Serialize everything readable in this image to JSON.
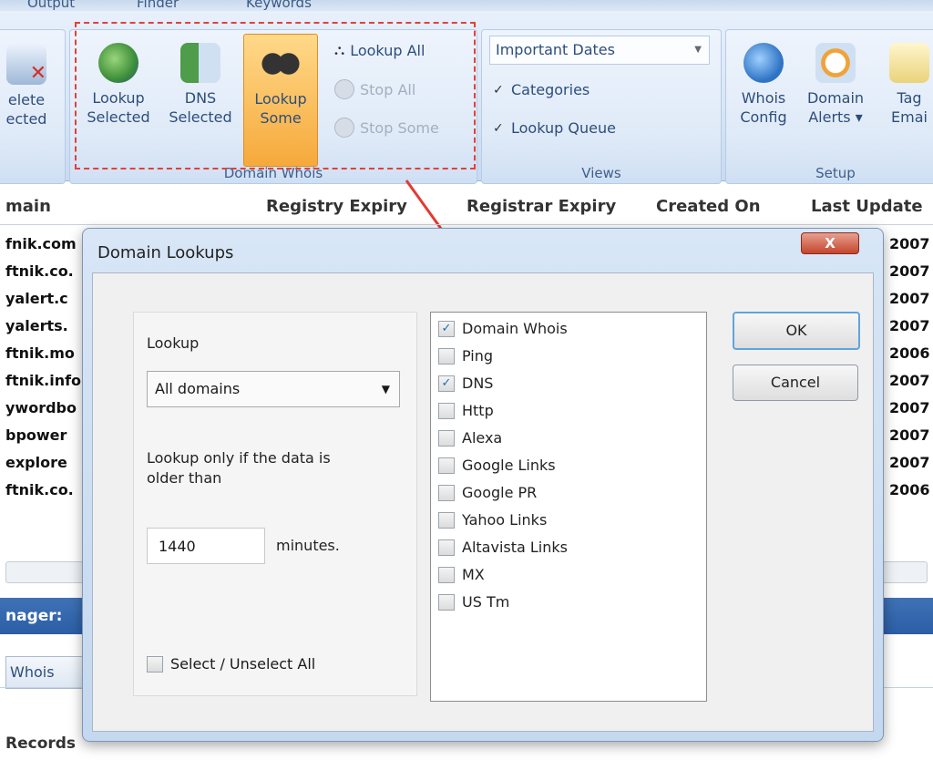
{
  "ribbon": {
    "tabs": [
      "Output",
      "Finder",
      "Keywords"
    ],
    "left_btn": {
      "label1": "elete",
      "label2": "ected"
    },
    "domain_whois": {
      "lookup_selected": {
        "l1": "Lookup",
        "l2": "Selected"
      },
      "dns_selected": {
        "l1": "DNS",
        "l2": "Selected"
      },
      "lookup_some": {
        "l1": "Lookup",
        "l2": "Some"
      },
      "lookup_all": "Lookup All",
      "stop_all": "Stop All",
      "stop_some": "Stop Some",
      "group_label": "Domain Whois"
    },
    "views": {
      "dropdown": "Important Dates",
      "categories": "Categories",
      "lookup_queue": "Lookup Queue",
      "group_label": "Views"
    },
    "setup": {
      "whois_config": {
        "l1": "Whois",
        "l2": "Config"
      },
      "domain_alerts": {
        "l1": "Domain",
        "l2": "Alerts ▾"
      },
      "tag_email": {
        "l1": "Tag",
        "l2": "Emai"
      },
      "group_label": "Setup"
    }
  },
  "grid": {
    "headers": {
      "domain": "main",
      "registry": "Registry Expiry",
      "registrar": "Registrar Expiry",
      "created": "Created On",
      "updated": "Last Update"
    },
    "rows": [
      {
        "domain": "fnik.com",
        "year": "2007"
      },
      {
        "domain": "ftnik.co.",
        "year": "2007"
      },
      {
        "domain": "yalert.c",
        "year": "2007"
      },
      {
        "domain": "yalerts.",
        "year": "2007"
      },
      {
        "domain": "ftnik.mo",
        "year": "2006"
      },
      {
        "domain": "ftnik.info",
        "year": "2007"
      },
      {
        "domain": "ywordbo",
        "year": "2007"
      },
      {
        "domain": "bpower",
        "year": "2007"
      },
      {
        "domain": "explore",
        "year": "2007"
      },
      {
        "domain": "ftnik.co.",
        "year": "2006"
      }
    ]
  },
  "status": {
    "manager": "nager: ",
    "whois_tab": "Whois",
    "records": "Records"
  },
  "dialog": {
    "title": "Domain Lookups",
    "close": "X",
    "lookup_label": "Lookup",
    "lookup_value": "All domains",
    "older_text_1": "Lookup only if the data is",
    "older_text_2": "older than",
    "minutes_value": "1440",
    "minutes_label": "minutes.",
    "select_all": "Select / Unselect All",
    "ok": "OK",
    "cancel": "Cancel",
    "items": [
      {
        "label": "Domain Whois",
        "checked": true
      },
      {
        "label": "Ping",
        "checked": false
      },
      {
        "label": "DNS",
        "checked": true
      },
      {
        "label": "Http",
        "checked": false
      },
      {
        "label": "Alexa",
        "checked": false
      },
      {
        "label": "Google Links",
        "checked": false
      },
      {
        "label": "Google PR",
        "checked": false
      },
      {
        "label": "Yahoo Links",
        "checked": false
      },
      {
        "label": "Altavista Links",
        "checked": false
      },
      {
        "label": "MX",
        "checked": false
      },
      {
        "label": "US Tm",
        "checked": false
      }
    ]
  }
}
